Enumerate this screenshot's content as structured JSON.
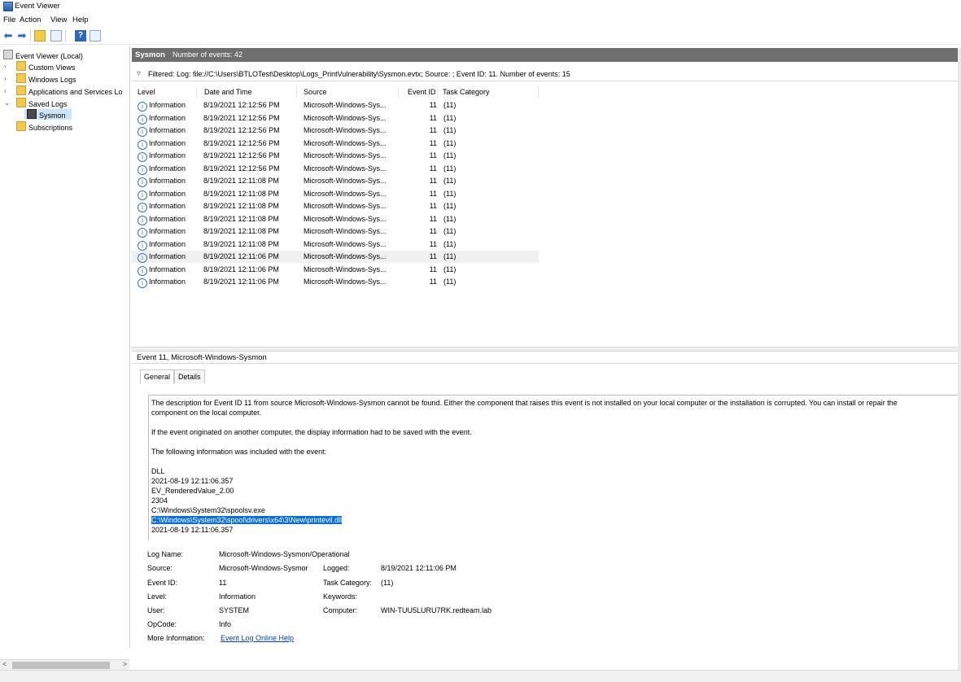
{
  "window": {
    "title": "Event Viewer"
  },
  "menu": [
    "File",
    "Action",
    "View",
    "Help"
  ],
  "toolbar_icons": [
    "back-arrow-icon",
    "forward-arrow-icon",
    "open-folder-icon",
    "properties-icon",
    "help-icon",
    "pane-icon"
  ],
  "tree": {
    "items": [
      {
        "label": "Event Viewer (Local)",
        "icon": "event-viewer-icon"
      },
      {
        "label": "Custom Views",
        "icon": "folder-icon"
      },
      {
        "label": "Windows Logs",
        "icon": "folder-icon"
      },
      {
        "label": "Applications and Services Lo",
        "icon": "folder-icon"
      },
      {
        "label": "Saved Logs",
        "icon": "folder-icon"
      },
      {
        "label": "Sysmon",
        "icon": "save-icon"
      },
      {
        "label": "Subscriptions",
        "icon": "folder-icon"
      }
    ]
  },
  "panel_header": {
    "name": "Sysmon",
    "count": "Number of events: 42"
  },
  "filter": {
    "text": "Filtered: Log: file://C:\\Users\\BTLOTest\\Desktop\\Logs_PrintVulnerability\\Sysmon.evtx; Source: ; Event ID: 11. Number of events: 15"
  },
  "columns": [
    "Level",
    "Date and Time",
    "Source",
    "Event ID",
    "Task Category"
  ],
  "rows": [
    {
      "level": "Information",
      "date": "8/19/2021 12:12:56 PM",
      "source": "Microsoft-Windows-Sys...",
      "id": "11",
      "cat": "(11)"
    },
    {
      "level": "Information",
      "date": "8/19/2021 12:12:56 PM",
      "source": "Microsoft-Windows-Sys...",
      "id": "11",
      "cat": "(11)"
    },
    {
      "level": "Information",
      "date": "8/19/2021 12:12:56 PM",
      "source": "Microsoft-Windows-Sys...",
      "id": "11",
      "cat": "(11)"
    },
    {
      "level": "Information",
      "date": "8/19/2021 12:12:56 PM",
      "source": "Microsoft-Windows-Sys...",
      "id": "11",
      "cat": "(11)"
    },
    {
      "level": "Information",
      "date": "8/19/2021 12:12:56 PM",
      "source": "Microsoft-Windows-Sys...",
      "id": "11",
      "cat": "(11)"
    },
    {
      "level": "Information",
      "date": "8/19/2021 12:12:56 PM",
      "source": "Microsoft-Windows-Sys...",
      "id": "11",
      "cat": "(11)"
    },
    {
      "level": "Information",
      "date": "8/19/2021 12:11:08 PM",
      "source": "Microsoft-Windows-Sys...",
      "id": "11",
      "cat": "(11)"
    },
    {
      "level": "Information",
      "date": "8/19/2021 12:11:08 PM",
      "source": "Microsoft-Windows-Sys...",
      "id": "11",
      "cat": "(11)"
    },
    {
      "level": "Information",
      "date": "8/19/2021 12:11:08 PM",
      "source": "Microsoft-Windows-Sys...",
      "id": "11",
      "cat": "(11)"
    },
    {
      "level": "Information",
      "date": "8/19/2021 12:11:08 PM",
      "source": "Microsoft-Windows-Sys...",
      "id": "11",
      "cat": "(11)"
    },
    {
      "level": "Information",
      "date": "8/19/2021 12:11:08 PM",
      "source": "Microsoft-Windows-Sys...",
      "id": "11",
      "cat": "(11)"
    },
    {
      "level": "Information",
      "date": "8/19/2021 12:11:08 PM",
      "source": "Microsoft-Windows-Sys...",
      "id": "11",
      "cat": "(11)"
    },
    {
      "level": "Information",
      "date": "8/19/2021 12:11:06 PM",
      "source": "Microsoft-Windows-Sys...",
      "id": "11",
      "cat": "(11)"
    },
    {
      "level": "Information",
      "date": "8/19/2021 12:11:06 PM",
      "source": "Microsoft-Windows-Sys...",
      "id": "11",
      "cat": "(11)"
    },
    {
      "level": "Information",
      "date": "8/19/2021 12:11:06 PM",
      "source": "Microsoft-Windows-Sys...",
      "id": "11",
      "cat": "(11)"
    }
  ],
  "detail": {
    "header": "Event 11, Microsoft-Windows-Sysmon",
    "tabs": [
      "General",
      "Details"
    ],
    "desc": {
      "line1": "The description for Event ID 11 from source Microsoft-Windows-Sysmon cannot be found. Either the component that raises this event is not installed on your local computer or the installation is corrupted. You can install or repair the",
      "line2": "component on the local computer.",
      "line3": "If the event originated on another computer, the display information had to be saved with the event.",
      "line4": "The following information was included with the event:",
      "values": [
        "DLL",
        "2021-08-19 12:11:06.357",
        "EV_RenderedValue_2.00",
        "2304",
        "C:\\Windows\\System32\\spoolsv.exe",
        "C:\\Windows\\System32\\spool\\drivers\\x64\\3\\New\\printevil.dll",
        "2021-08-19 12:11:06.357"
      ]
    },
    "props": {
      "log_name_label": "Log Name:",
      "log_name": "Microsoft-Windows-Sysmon/Operational",
      "source_label": "Source:",
      "source": "Microsoft-Windows-Sysmor",
      "logged_label": "Logged:",
      "logged": "8/19/2021 12:11:06 PM",
      "event_id_label": "Event ID:",
      "event_id": "11",
      "task_label": "Task Category:",
      "task": "(11)",
      "level_label": "Level:",
      "level": "Information",
      "keywords_label": "Keywords:",
      "user_label": "User:",
      "user": "SYSTEM",
      "computer_label": "Computer:",
      "computer": "WIN-TUU5LURU7RK.redteam.lab",
      "opcode_label": "OpCode:",
      "opcode": "Info",
      "more_label": "More Information:",
      "more_link": "Event Log Online Help"
    }
  },
  "scroll": {
    "left": "<",
    "right": ">"
  },
  "colors": {
    "header_bg": "#6e6e6e",
    "highlight": "#0b6ed4",
    "link": "#0645ad"
  }
}
